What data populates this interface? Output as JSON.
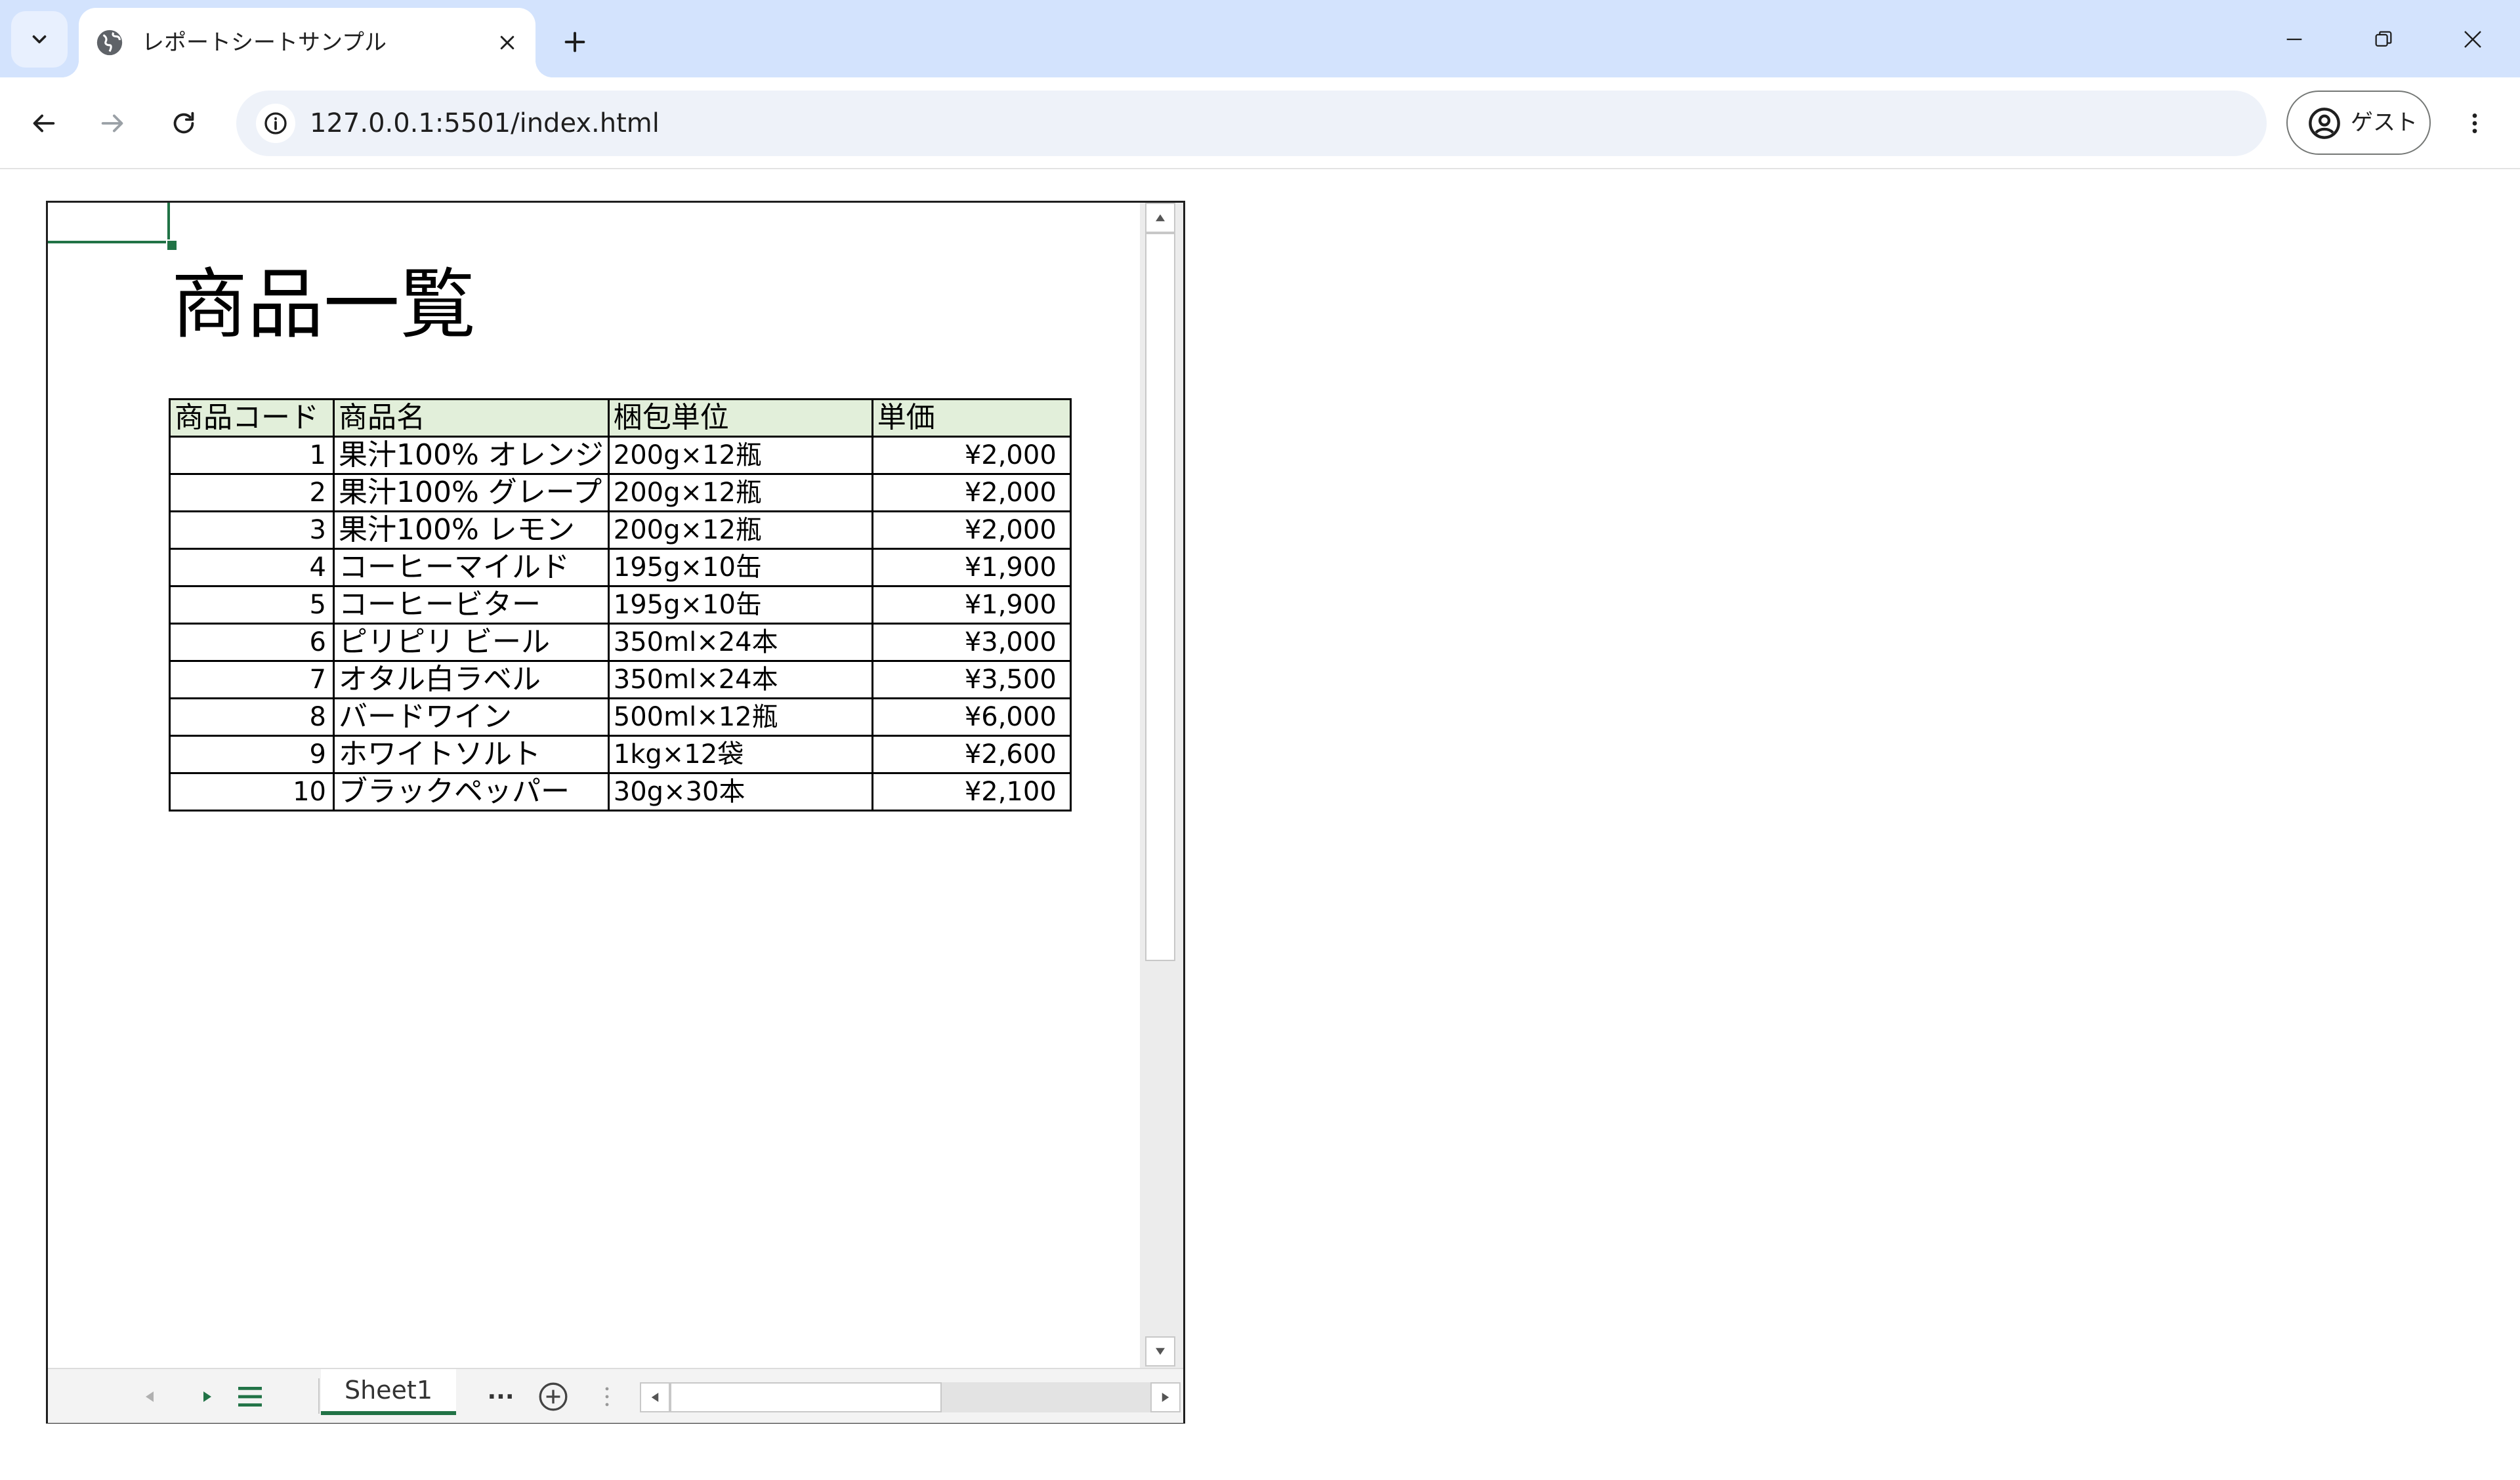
{
  "browser": {
    "tab_title": "レポートシートサンプル",
    "url": "127.0.0.1:5501/index.html",
    "profile_label": "ゲスト"
  },
  "sheet": {
    "title": "商品一覧",
    "columns": [
      "商品コード",
      "商品名",
      "梱包単位",
      "単価"
    ],
    "rows": [
      {
        "code": "1",
        "name": "果汁100% オレンジ",
        "pack": "200g×12瓶",
        "price": "¥2,000"
      },
      {
        "code": "2",
        "name": "果汁100% グレープ",
        "pack": "200g×12瓶",
        "price": "¥2,000"
      },
      {
        "code": "3",
        "name": "果汁100% レモン",
        "pack": "200g×12瓶",
        "price": "¥2,000"
      },
      {
        "code": "4",
        "name": "コーヒーマイルド",
        "pack": "195g×10缶",
        "price": "¥1,900"
      },
      {
        "code": "5",
        "name": "コーヒービター",
        "pack": "195g×10缶",
        "price": "¥1,900"
      },
      {
        "code": "6",
        "name": "ピリピリ ビール",
        "pack": "350ml×24本",
        "price": "¥3,000"
      },
      {
        "code": "7",
        "name": "オタル白ラベル",
        "pack": "350ml×24本",
        "price": "¥3,500"
      },
      {
        "code": "8",
        "name": "バードワイン",
        "pack": "500ml×12瓶",
        "price": "¥6,000"
      },
      {
        "code": "9",
        "name": "ホワイトソルト",
        "pack": "1kg×12袋",
        "price": "¥2,600"
      },
      {
        "code": "10",
        "name": "ブラックペッパー",
        "pack": "30g×30本",
        "price": "¥2,100"
      }
    ],
    "sheet_tab": "Sheet1",
    "more_label": "···"
  },
  "colors": {
    "accent": "#217346",
    "header_fill": "#e2efda",
    "titlebar": "#d3e3fd"
  }
}
